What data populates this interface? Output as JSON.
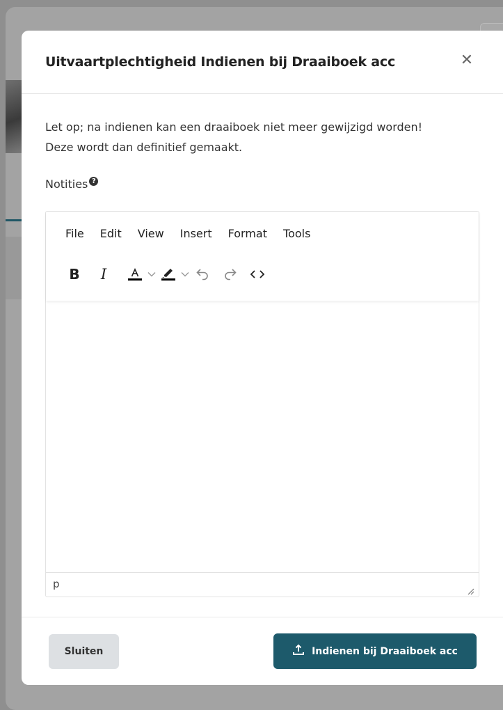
{
  "modal": {
    "title": "Uitvaartplechtigheid Indienen bij Draaiboek acc",
    "close_icon": "close-icon",
    "notice_line1": "Let op; na indienen kan een draaiboek niet meer gewijzigd worden!",
    "notice_line2": "Deze wordt dan definitief gemaakt.",
    "notes_label": "Notities",
    "help_glyph": "?"
  },
  "editor": {
    "menu": [
      "File",
      "Edit",
      "View",
      "Insert",
      "Format",
      "Tools"
    ],
    "toolbar": {
      "bold": "B",
      "italic": "I",
      "text_color_icon": "text-color-icon",
      "highlight_icon": "highlight-color-icon",
      "undo_icon": "undo-icon",
      "redo_icon": "redo-icon",
      "code_icon": "source-code-icon"
    },
    "content": "",
    "path": "p"
  },
  "footer": {
    "close_label": "Sluiten",
    "submit_label": "Indienen bij Draaiboek acc",
    "submit_icon": "upload-icon"
  },
  "colors": {
    "primary": "#1d5a6b",
    "secondary_button": "#dde0e3",
    "overlay": "#8f8f8f"
  }
}
